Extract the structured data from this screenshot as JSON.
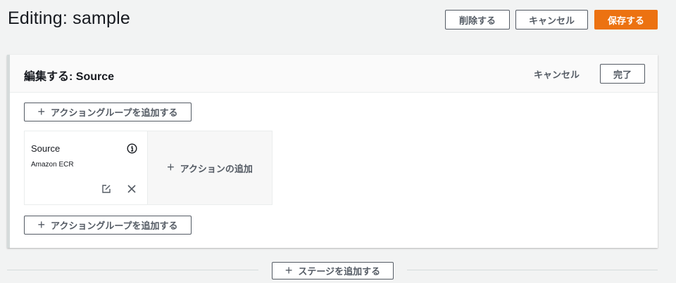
{
  "header": {
    "title": "Editing: sample",
    "delete_label": "削除する",
    "cancel_label": "キャンセル",
    "save_label": "保存する"
  },
  "stage": {
    "title": "編集する: Source",
    "cancel_label": "キャンセル",
    "done_label": "完了",
    "add_action_group_label": "アクショングループを追加する",
    "action": {
      "name": "Source",
      "provider": "Amazon ECR"
    },
    "add_action_label": "アクションの追加"
  },
  "footer": {
    "add_stage_label": "ステージを追加する"
  },
  "icons": {
    "info": "info-icon",
    "edit": "edit-icon",
    "delete": "close-icon",
    "plus": "plus-icon"
  },
  "colors": {
    "primary": "#ec7211",
    "background": "#f2f3f3",
    "text": "#16191f",
    "secondary_text": "#545b64"
  }
}
